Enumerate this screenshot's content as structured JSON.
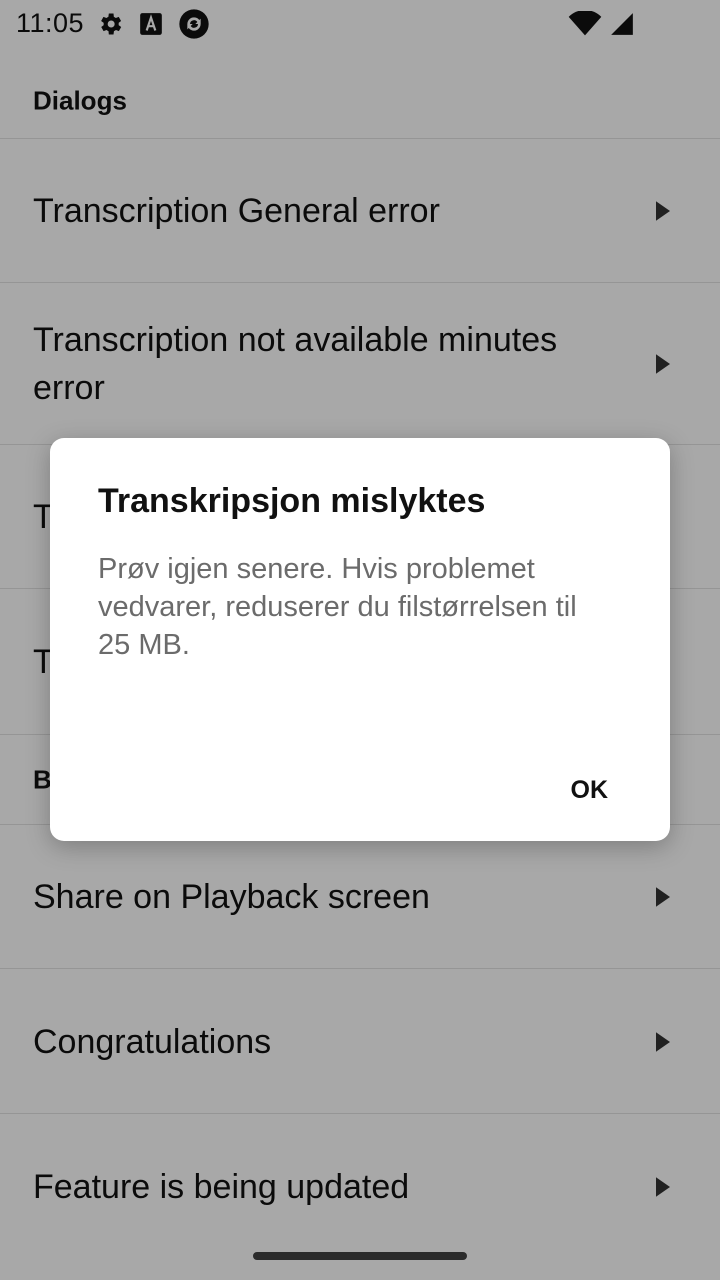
{
  "status_bar": {
    "time": "11:05",
    "left_icons": [
      "gear-icon",
      "text-a-icon",
      "sync-icon"
    ],
    "right_icons": [
      "wifi-icon",
      "signal-icon"
    ]
  },
  "sections": {
    "dialogs_header": "Dialogs",
    "second_header": "B"
  },
  "list": {
    "items": [
      "Transcription General error",
      "Transcription not available minutes error",
      "T",
      "T",
      "Share on Playback screen",
      "Congratulations",
      "Feature is being updated"
    ]
  },
  "dialog": {
    "title": "Transkripsjon mislyktes",
    "message": "Prøv igjen senere. Hvis problemet vedvarer, reduserer du filstørrelsen til 25 MB.",
    "ok_label": "OK"
  },
  "colors": {
    "scrim": "#000000",
    "dialog_bg": "#ffffff",
    "message_text": "#6b6b6b"
  }
}
